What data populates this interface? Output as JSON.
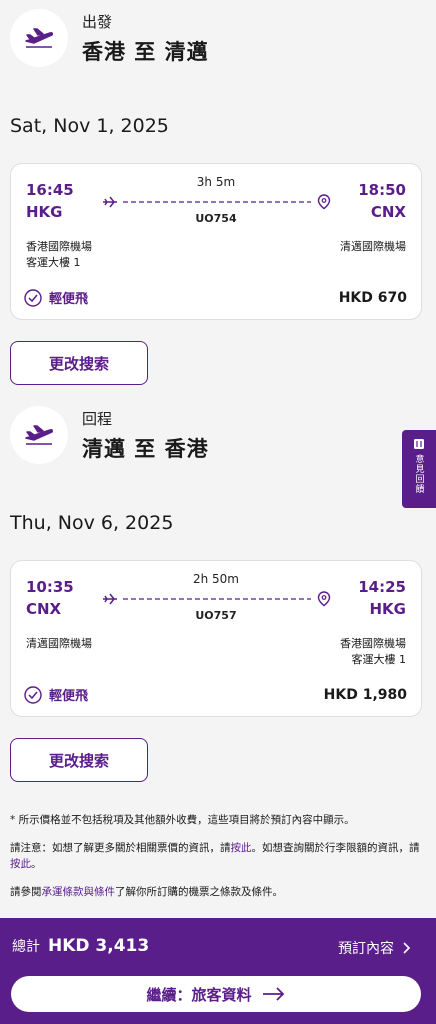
{
  "outbound": {
    "label": "出發",
    "route": "香港 至 清邁",
    "date": "Sat, Nov 1, 2025",
    "flight": {
      "dep_time": "16:45",
      "dep_code": "HKG",
      "arr_time": "18:50",
      "arr_code": "CNX",
      "duration": "3h 5m",
      "flight_no": "UO754",
      "dep_airport": "香港國際機場",
      "dep_terminal": "客運大樓 1",
      "arr_airport": "清邁國際機場",
      "fare_name": "輕便飛",
      "price": "HKD 670"
    },
    "change_label": "更改搜索"
  },
  "inbound": {
    "label": "回程",
    "route": "清邁 至 香港",
    "date": "Thu, Nov 6, 2025",
    "flight": {
      "dep_time": "10:35",
      "dep_code": "CNX",
      "arr_time": "14:25",
      "arr_code": "HKG",
      "duration": "2h 50m",
      "flight_no": "UO757",
      "dep_airport": "清邁國際機場",
      "arr_airport": "香港國際機場",
      "arr_terminal": "客運大樓 1",
      "fare_name": "輕便飛",
      "price": "HKD 1,980"
    },
    "change_label": "更改搜索"
  },
  "feedback": {
    "label": "意見回饋"
  },
  "notes": {
    "note1": "* 所示價格並不包括稅項及其他額外收費，這些項目將於預訂內容中顯示。",
    "note2_a": "請注意：如想了解更多關於相關票價的資訊，請",
    "note2_link1": "按此",
    "note2_b": "。如想查詢關於行李限額的資訊，請",
    "note2_link2": "按此",
    "note2_c": "。",
    "note3_a": "請參閱",
    "note3_link": "承運條款與條件",
    "note3_b": "了解你所訂購的機票之條款及條件。"
  },
  "bottom": {
    "total_label": "總計",
    "total_amount": "HKD 3,413",
    "booking_label": "預訂內容",
    "continue_label": "繼續：旅客資料"
  },
  "colors": {
    "accent": "#5a1e8a",
    "background": "#f4f4f5"
  },
  "icons": [
    "airplane-icon",
    "origin-plane-icon",
    "destination-pin-icon",
    "check-circle-icon",
    "feedback-icon",
    "chevron-right-icon",
    "arrow-right-icon"
  ]
}
